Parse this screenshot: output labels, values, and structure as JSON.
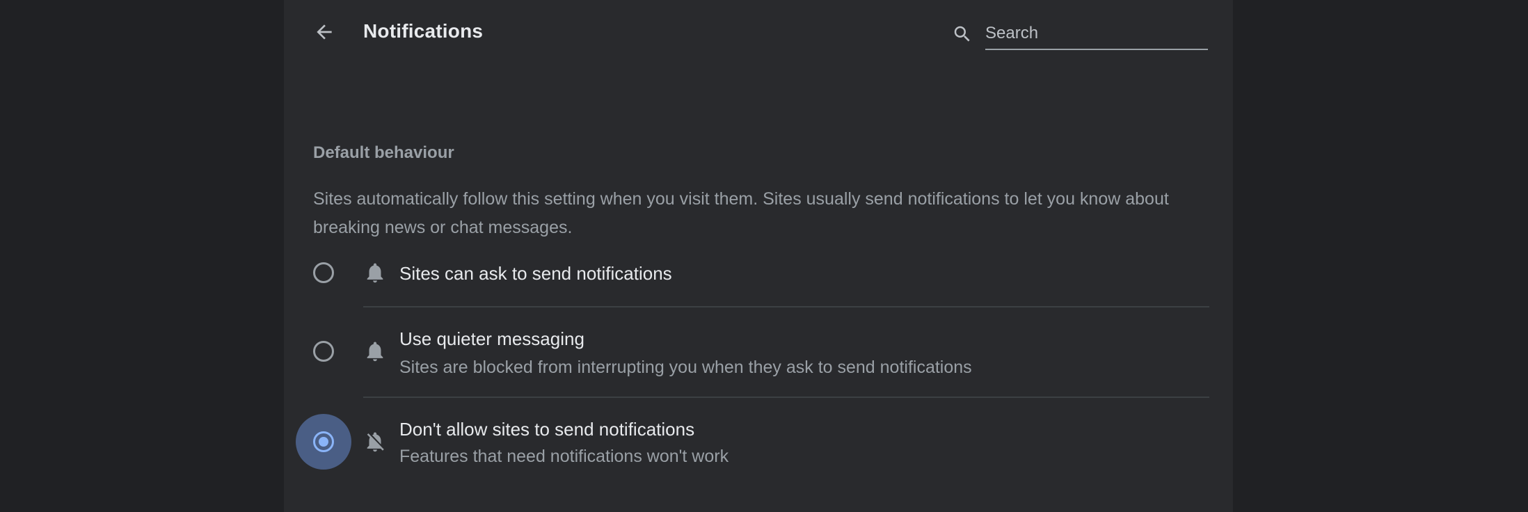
{
  "header": {
    "title": "Notifications",
    "search_placeholder": "Search"
  },
  "section": {
    "heading": "Default behaviour",
    "description": "Sites automatically follow this setting when you visit them. Sites usually send notifications to let you know about breaking news or chat messages."
  },
  "options": [
    {
      "label": "Sites can ask to send notifications",
      "sublabel": "",
      "icon": "bell-icon",
      "checked": false
    },
    {
      "label": "Use quieter messaging",
      "sublabel": "Sites are blocked from interrupting you when they ask to send notifications",
      "icon": "bell-icon",
      "checked": false
    },
    {
      "label": "Don't allow sites to send notifications",
      "sublabel": "Features that need notifications won't work",
      "icon": "bell-off-icon",
      "checked": true
    }
  ],
  "colors": {
    "background": "#202124",
    "panel": "#292a2d",
    "accent": "#8ab4f8",
    "text_primary": "#e8eaed",
    "text_secondary": "#9aa0a6"
  }
}
